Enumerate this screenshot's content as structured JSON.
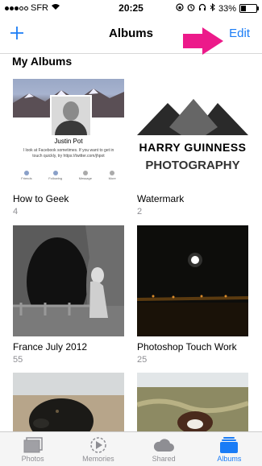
{
  "status_bar": {
    "carrier": "SFR",
    "time": "20:25",
    "battery": "33%"
  },
  "nav": {
    "title": "Albums",
    "edit_label": "Edit",
    "add_icon": "plus-icon"
  },
  "section_title": "My Albums",
  "albums": [
    {
      "name": "How to Geek",
      "count": "4",
      "preview": {
        "profile_name": "Justin Pot",
        "bio": "I look at Facebook sometimes. If you want to get in touch quickly, try https://twitter.com/jhpot",
        "tabs": [
          "Friends",
          "Following",
          "Message",
          "More"
        ]
      }
    },
    {
      "name": "Watermark",
      "count": "2",
      "preview": {
        "line1": "HARRY GUINNESS",
        "line2": "PHOTOGRAPHY"
      }
    },
    {
      "name": "France July 2012",
      "count": "55"
    },
    {
      "name": "Photoshop Touch Work",
      "count": "25"
    },
    {
      "name": "",
      "count": ""
    },
    {
      "name": "",
      "count": ""
    }
  ],
  "tab_bar": {
    "items": [
      {
        "label": "Photos",
        "icon": "photos-icon",
        "active": false
      },
      {
        "label": "Memories",
        "icon": "memories-icon",
        "active": false
      },
      {
        "label": "Shared",
        "icon": "cloud-icon",
        "active": false
      },
      {
        "label": "Albums",
        "icon": "albums-icon",
        "active": true
      }
    ]
  },
  "colors": {
    "accent": "#1a7cf6",
    "annotation_arrow": "#ec1a8a"
  }
}
